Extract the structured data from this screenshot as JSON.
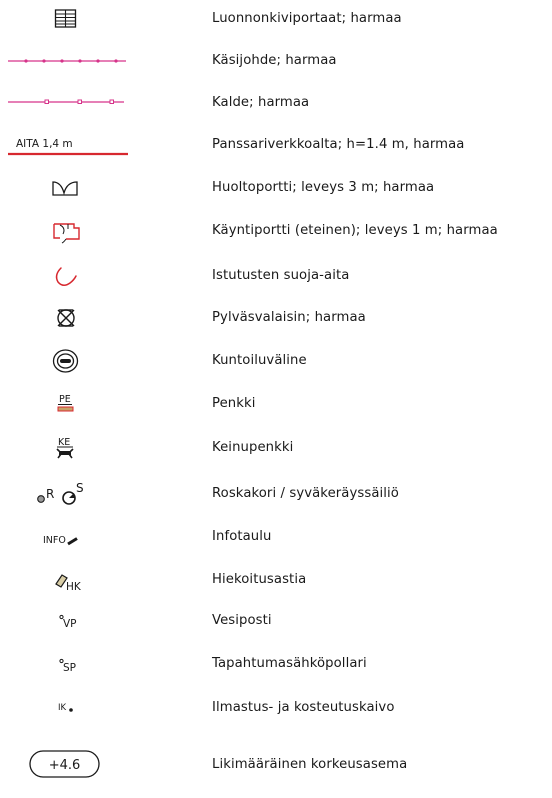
{
  "legend": {
    "items": [
      {
        "symbol_text": "",
        "label": "Luonnonkiviportaat; harmaa",
        "icon": "stairs-icon"
      },
      {
        "symbol_text": "",
        "label": "Käsijohde; harmaa",
        "icon": "handrail-line-icon"
      },
      {
        "symbol_text": "",
        "label": "Kalde; harmaa",
        "icon": "railing-line-icon"
      },
      {
        "symbol_text": "AITA 1,4 m",
        "label": "Panssariverkkoalta; h=1.4 m, harmaa",
        "icon": "mesh-fence-icon"
      },
      {
        "symbol_text": "",
        "label": "Huoltoportti; leveys 3 m; harmaa",
        "icon": "service-gate-icon"
      },
      {
        "symbol_text": "",
        "label": "Käyntiportti (eteinen); leveys 1 m; harmaa",
        "icon": "entry-gate-icon"
      },
      {
        "symbol_text": "",
        "label": "Istutusten suoja-aita",
        "icon": "plant-fence-icon"
      },
      {
        "symbol_text": "",
        "label": "Pylväsvalaisin; harmaa",
        "icon": "pole-lamp-icon"
      },
      {
        "symbol_text": "",
        "label": "Kuntoiluväline",
        "icon": "exercise-equipment-icon"
      },
      {
        "symbol_text": "PE",
        "label": "Penkki",
        "icon": "bench-icon"
      },
      {
        "symbol_text": "KE",
        "label": "Keinupenkki",
        "icon": "swing-bench-icon"
      },
      {
        "symbol_text": "R",
        "symbol_text_2": "S",
        "label": "Roskakori / syväkeräyssäiliö",
        "icon": "trash-bin-icon"
      },
      {
        "symbol_text": "INFO",
        "label": "Infotaulu",
        "icon": "info-board-icon"
      },
      {
        "symbol_text": "HK",
        "label": "Hiekoitusastia",
        "icon": "sand-container-icon"
      },
      {
        "symbol_text": "VP",
        "label": "Vesiposti",
        "icon": "water-post-icon"
      },
      {
        "symbol_text": "SP",
        "label": "Tapahtumasähköpollari",
        "icon": "power-bollard-icon"
      },
      {
        "symbol_text": "IK",
        "label": "Ilmastus- ja kosteutuskaivo",
        "icon": "aeration-well-icon"
      },
      {
        "symbol_text": "+4.6",
        "label": "Likimääräinen korkeusasema",
        "icon": "elevation-marker-icon"
      }
    ],
    "colors": {
      "red": "#d7282f",
      "magenta": "#d6338a",
      "ink": "#1a1a1a"
    }
  }
}
